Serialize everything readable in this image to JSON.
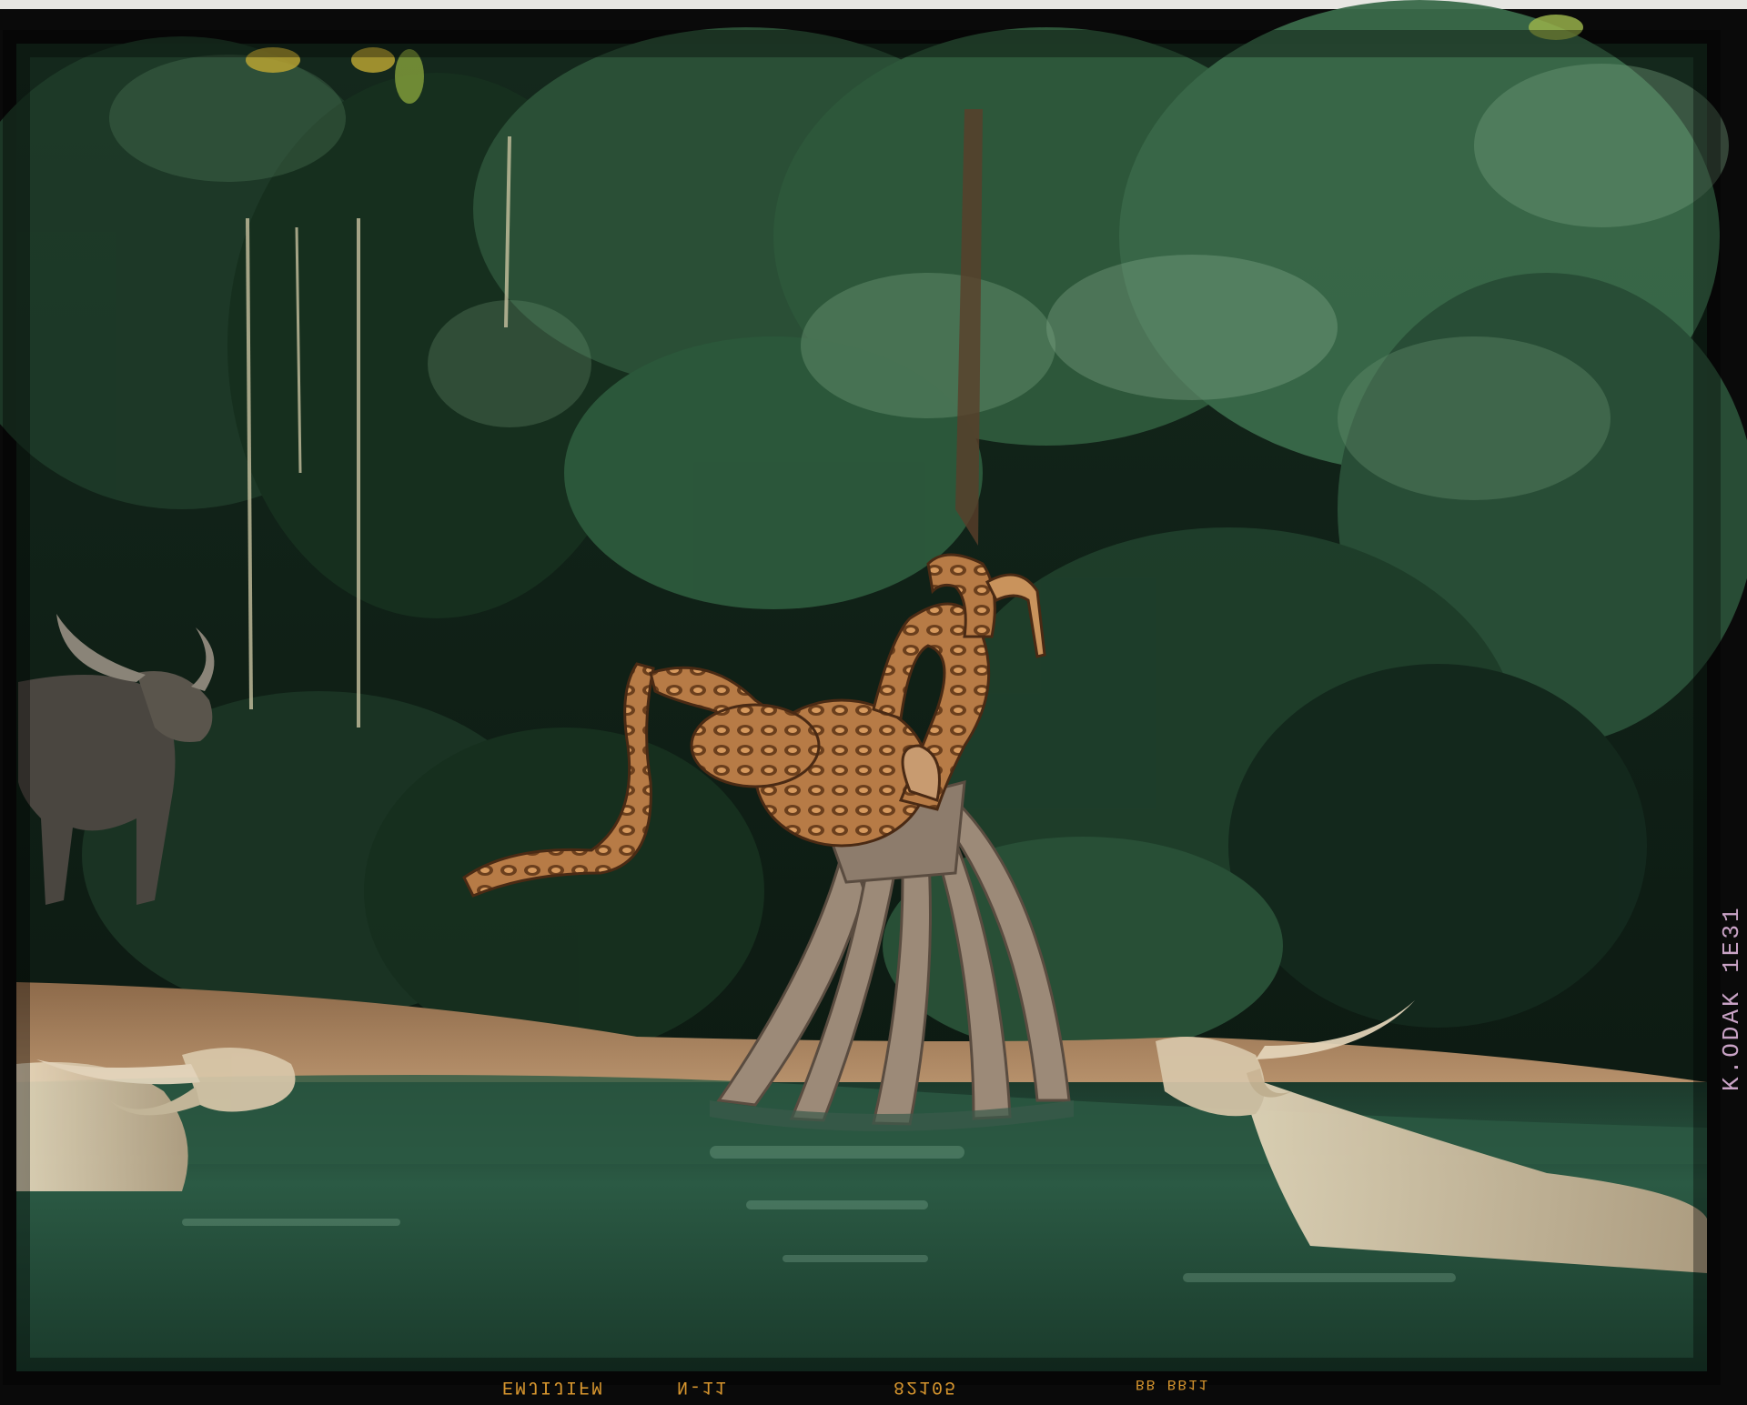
{
  "film_edge": {
    "right_code": "K.ODAK 1E31",
    "bottom_codes": [
      "EMJIJIFM",
      "N-11",
      "82105",
      "BB BB11"
    ]
  },
  "scene": {
    "subjects": [
      "python-sculpture",
      "mangrove-roots",
      "water-buffalo-left-standing",
      "water-buffalo-left-wading",
      "water-buffalo-right-wading",
      "jungle-foliage",
      "green-river"
    ]
  },
  "colors": {
    "foliage_dark": "#0d1f16",
    "foliage_mid": "#2f5a3c",
    "foliage_light": "#6f9c78",
    "water": "#244c3a",
    "python": "#b57a45",
    "roots": "#9c8a78",
    "buffalo": "#d8c7aa",
    "bank": "#9a7452",
    "film_border": "#0a0a0a"
  }
}
